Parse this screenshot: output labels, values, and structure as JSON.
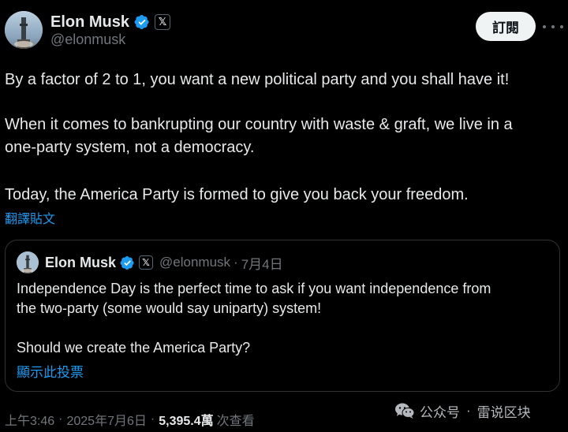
{
  "author": {
    "display_name": "Elon Musk",
    "handle": "@elonmusk",
    "verified_icon": "verified-badge-icon",
    "affiliation_icon": "x-logo-icon",
    "x_badge_glyph": "𝕏"
  },
  "header": {
    "follow_label": "訂閱",
    "more_icon": "more-options-icon"
  },
  "tweet": {
    "line1": "By a factor of 2 to 1, you want a new political party and you shall have it!",
    "line2": "When it comes to bankrupting our country with waste & graft, we live in a",
    "line3": "one-party system, not a democracy.",
    "line4": "Today, the America Party is formed to give you back your freedom.",
    "translate_label": "翻譯貼文"
  },
  "quote": {
    "display_name": "Elon Musk",
    "handle": "@elonmusk",
    "separator": "·",
    "date": "7月4日",
    "line1": "Independence Day is the perfect time to ask if you want independence from",
    "line2": "the two-party (some would say uniparty) system!",
    "line3": "Should we create the America Party?",
    "show_poll_label": "顯示此投票"
  },
  "meta": {
    "time": "上午3:46",
    "date": "2025年7月6日",
    "separator": "·",
    "views_count": "5,395.4萬",
    "views_label": "次查看"
  },
  "watermark": {
    "icon": "wechat-icon",
    "label1": "公众号",
    "separator": "·",
    "label2": "雷说区块"
  },
  "colors": {
    "background": "#000000",
    "text": "#e7e9ea",
    "secondary": "#71767b",
    "link": "#1d9bf0",
    "verified": "#1d9bf0",
    "border": "#2f3336",
    "follow_bg": "#eff3f4"
  }
}
